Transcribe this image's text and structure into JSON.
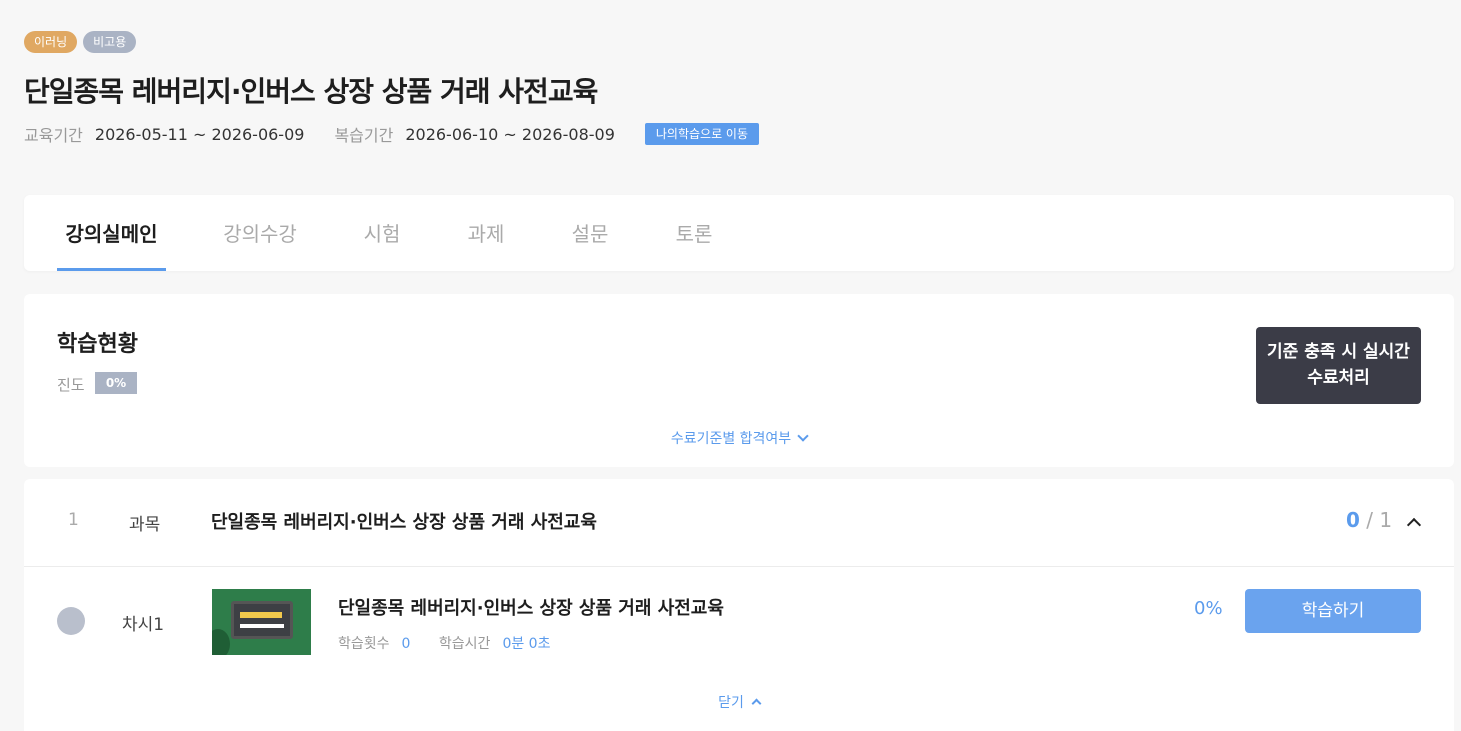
{
  "header": {
    "badges": [
      "이러닝",
      "비고용"
    ],
    "title": "단일종목 레버리지·인버스 상장 상품 거래 사전교육",
    "education_period_label": "교육기간",
    "education_period_value": "2026-05-11 ~ 2026-06-09",
    "review_period_label": "복습기간",
    "review_period_value": "2026-06-10 ~ 2026-08-09",
    "goto_button": "나의학습으로 이동"
  },
  "tabs": [
    "강의실메인",
    "강의수강",
    "시험",
    "과제",
    "설문",
    "토론"
  ],
  "active_tab": "강의실메인",
  "status": {
    "title": "학습현황",
    "progress_label": "진도",
    "progress_value": "0%",
    "criteria_link": "수료기준별 합격여부",
    "realtime_button_line1": "기준 충족 시 실시간",
    "realtime_button_line2": "수료처리"
  },
  "course": {
    "number": "1",
    "type": "과목",
    "name": "단일종목 레버리지·인버스 상장 상품 거래 사전교육",
    "done_count": "0",
    "separator": "/",
    "total_count": "1",
    "lesson": {
      "label": "차시1",
      "title": "단일종목 레버리지·인버스 상장 상품 거래 사전교육",
      "count_label": "학습횟수",
      "count_value": "0",
      "time_label": "학습시간",
      "time_value": "0분 0초",
      "percent": "0%",
      "study_button": "학습하기"
    },
    "close_link": "닫기"
  },
  "colors": {
    "accent": "#5b9bec",
    "badge_orange": "#e0a862",
    "badge_gray": "#aab3c4",
    "dark_button": "#3b3c47"
  }
}
